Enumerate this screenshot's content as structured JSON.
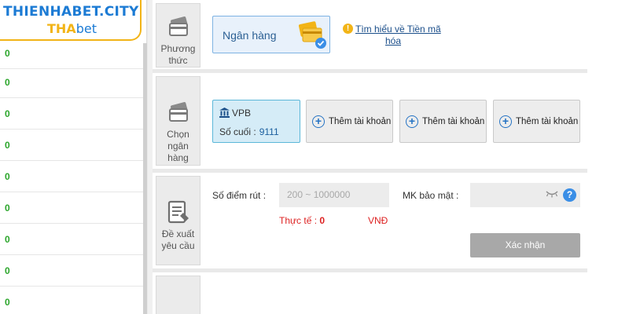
{
  "brand": {
    "logo_line1": "THIENHABET.CITY",
    "logo_line2_prefix": "THA",
    "logo_line2_suffix": "bet"
  },
  "sidebar": {
    "rows": [
      "0",
      "0",
      "0",
      "0",
      "0",
      "0",
      "0",
      "0",
      "0"
    ]
  },
  "method_section": {
    "step_label": "Phương thức",
    "selected_method": "Ngân hàng",
    "info_link_line1": "Tìm hiểu về Tiền mã",
    "info_link_line2": "hóa"
  },
  "bank_section": {
    "step_label": "Chọn ngân hàng",
    "selected_bank": {
      "name": "VPB",
      "last_digits_label": "Số cuối :",
      "last_digits": "9111"
    },
    "add_buttons": [
      "Thêm tài khoản",
      "Thêm tài khoản",
      "Thêm tài khoản"
    ]
  },
  "request_section": {
    "step_label": "Đề xuất yêu cầu",
    "amount_label": "Số điểm rút :",
    "amount_placeholder": "200 ~ 1000000",
    "password_label": "MK bảo mật :",
    "password_value": "",
    "actual_label": "Thực tế :",
    "actual_value": "0",
    "currency": "VNĐ",
    "confirm_label": "Xác nhận"
  },
  "colors": {
    "accent_blue": "#2573c4",
    "logo_gold": "#f2b417",
    "success_green": "#2aa52a",
    "warning_red": "#dd2222"
  }
}
